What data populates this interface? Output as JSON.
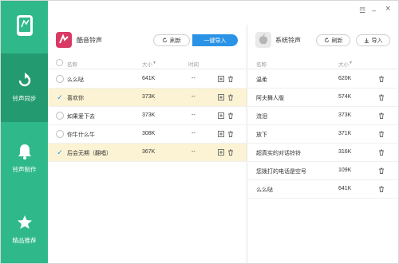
{
  "app": {
    "accent": "#2fb98a",
    "window_controls": {
      "menu": "☲",
      "minimize": "–",
      "close": "×"
    }
  },
  "sidebar": {
    "items": [
      {
        "label": "铃声同步",
        "icon": "sync-arrow-icon",
        "active": true
      },
      {
        "label": "铃声制作",
        "icon": "bell-icon",
        "active": false
      },
      {
        "label": "精品推荐",
        "icon": "star-icon",
        "active": false
      }
    ]
  },
  "left_panel": {
    "title": "酷音铃声",
    "refresh_label": "刷新",
    "import_label": "一键导入",
    "columns": {
      "name": "名称",
      "size": "大小",
      "time": "时间"
    },
    "rows": [
      {
        "name": "么么哒",
        "size": "641K",
        "time": "--",
        "checked": false
      },
      {
        "name": "喜欢你",
        "size": "373K",
        "time": "--",
        "checked": true
      },
      {
        "name": "如果爱下去",
        "size": "373K",
        "time": "--",
        "checked": false
      },
      {
        "name": "你牛什么牛",
        "size": "308K",
        "time": "--",
        "checked": false
      },
      {
        "name": "后会无期（翻唱）",
        "size": "367K",
        "time": "--",
        "checked": true
      }
    ]
  },
  "right_panel": {
    "title": "系统铃声",
    "refresh_label": "刷新",
    "import_label": "导入",
    "columns": {
      "name": "名称",
      "size": "大小"
    },
    "rows": [
      {
        "name": "温柔",
        "size": "620K"
      },
      {
        "name": "阿夫舞人版",
        "size": "574K"
      },
      {
        "name": "流泪",
        "size": "373K"
      },
      {
        "name": "放下",
        "size": "371K"
      },
      {
        "name": "超真实的对话铃铃",
        "size": "316K"
      },
      {
        "name": "您拨打的电话是空号",
        "size": "109K"
      },
      {
        "name": "么么哒",
        "size": "641K"
      }
    ]
  }
}
